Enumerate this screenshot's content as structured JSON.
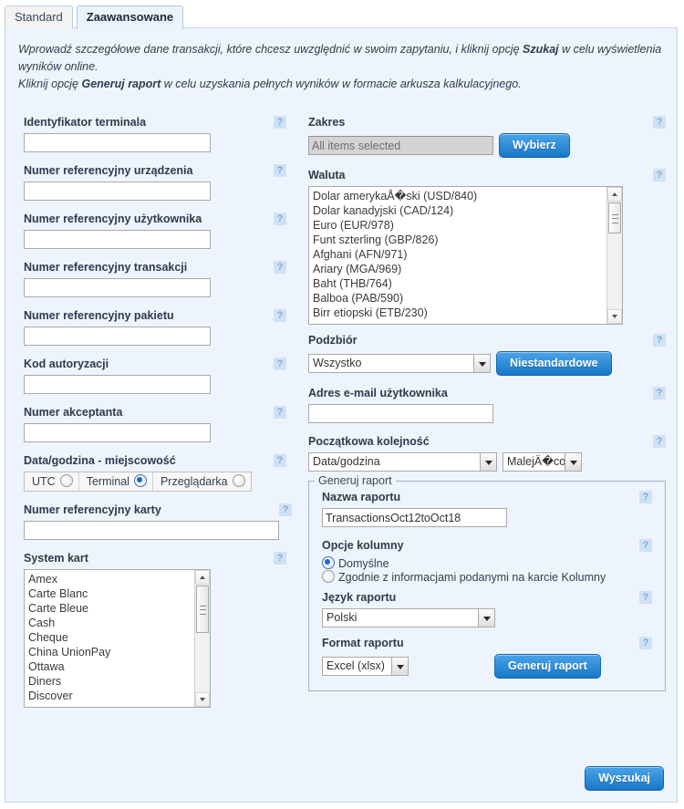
{
  "tabs": [
    {
      "label": "Standard",
      "active": false
    },
    {
      "label": "Zaawansowane",
      "active": true
    }
  ],
  "intro": {
    "line1_a": "Wprowadź szczegółowe dane transakcji, które chcesz uwzględnić w swoim zapytaniu, i kliknij opcję ",
    "line1_b": "Szukaj",
    "line1_c": " w celu wyświetlenia wyników online.",
    "line2_a": "Kliknij opcję ",
    "line2_b": "Generuj raport",
    "line2_c": " w celu uzyskania pełnych wyników w formacie arkusza kalkulacyjnego."
  },
  "icons": {
    "help": "?"
  },
  "colors": {
    "panel_bg": "#eef4fd",
    "accent_button": "#1878c8",
    "help_icon_bg": "#cfe2f5",
    "active_tab_bg": "#eaf3fc"
  },
  "left": {
    "terminal_id": {
      "label": "Identyfikator terminala",
      "value": "",
      "placeholder": ""
    },
    "device_ref": {
      "label": "Numer referencyjny urządzenia",
      "value": "",
      "placeholder": ""
    },
    "user_ref": {
      "label": "Numer referencyjny użytkownika",
      "value": "",
      "placeholder": ""
    },
    "txn_ref": {
      "label": "Numer referencyjny transakcji",
      "value": "",
      "placeholder": ""
    },
    "batch_ref": {
      "label": "Numer referencyjny pakietu",
      "value": "",
      "placeholder": ""
    },
    "auth_code": {
      "label": "Kod autoryzacji",
      "value": "",
      "placeholder": ""
    },
    "merchant_no": {
      "label": "Numer akceptanta",
      "value": "",
      "placeholder": ""
    },
    "datetime_locality": {
      "label": "Data/godzina - miejscowość",
      "options": [
        {
          "label": "UTC",
          "selected": false
        },
        {
          "label": "Terminal",
          "selected": true
        },
        {
          "label": "Przeglądarka",
          "selected": false
        }
      ]
    },
    "card_ref": {
      "label": "Numer referencyjny karty",
      "value": "",
      "placeholder": ""
    },
    "card_scheme": {
      "label": "System kart",
      "options": [
        "Amex",
        "Carte Blanc",
        "Carte Bleue",
        "Cash",
        "Cheque",
        "China UnionPay",
        "Ottawa",
        "Diners",
        "Discover"
      ]
    }
  },
  "right": {
    "range": {
      "label": "Zakres",
      "value": "All items selected",
      "placeholder": "All items selected",
      "button": "Wybierz"
    },
    "currency": {
      "label": "Waluta",
      "options": [
        "Dolar amerykaÅ�ski (USD/840)",
        "Dolar kanadyjski (CAD/124)",
        "Euro (EUR/978)",
        "Funt szterling (GBP/826)",
        "Afghani (AFN/971)",
        "Ariary (MGA/969)",
        "Baht (THB/764)",
        "Balboa (PAB/590)",
        "Birr etiopski (ETB/230)"
      ]
    },
    "subset": {
      "label": "Podzbiór",
      "value": "Wszystko",
      "button": "Niestandardowe"
    },
    "user_email": {
      "label": "Adres e-mail użytkownika",
      "value": "",
      "placeholder": ""
    },
    "initial_order": {
      "label": "Początkowa kolejność",
      "field_value": "Data/godzina",
      "direction_value": "MalejÄ�co"
    },
    "generate_report": {
      "legend": "Generuj raport",
      "report_name": {
        "label": "Nazwa raportu",
        "value": "TransactionsOct12toOct18",
        "placeholder": ""
      },
      "column_options": {
        "label": "Opcje kolumny",
        "options": [
          {
            "label": "Domyślne",
            "selected": true
          },
          {
            "label": "Zgodnie z informacjami podanymi na karcie Kolumny",
            "selected": false
          }
        ]
      },
      "report_language": {
        "label": "Język raportu",
        "value": "Polski"
      },
      "report_format": {
        "label": "Format raportu",
        "value": "Excel (xlsx)"
      },
      "button": "Generuj raport"
    }
  },
  "footer": {
    "search_button": "Wyszukaj"
  }
}
